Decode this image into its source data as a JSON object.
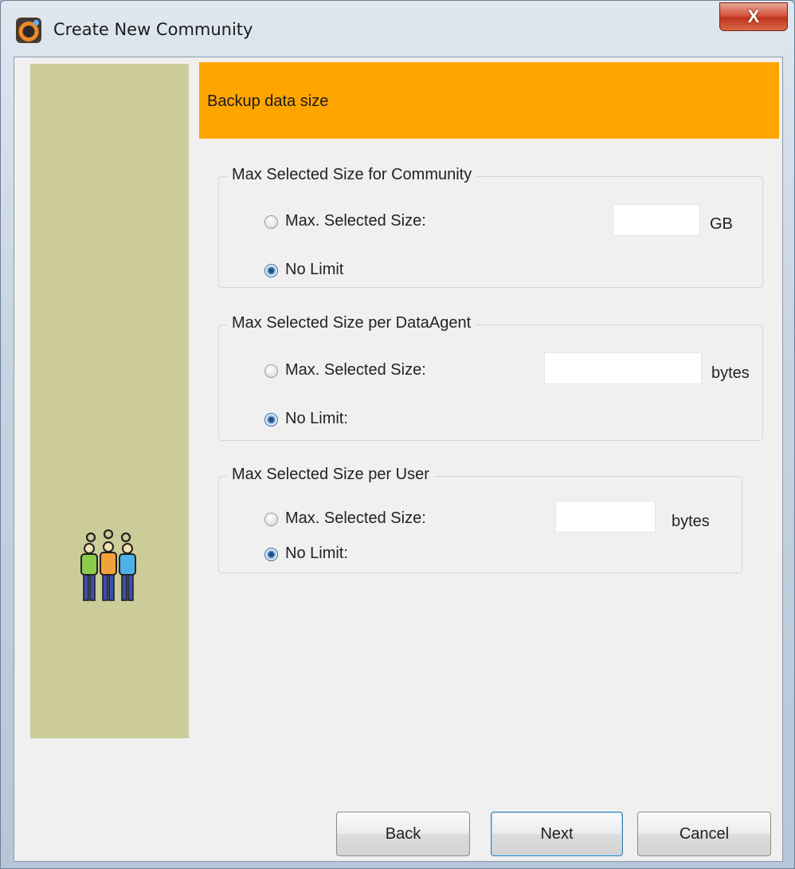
{
  "window": {
    "title": "Create New Community",
    "close_label": "X"
  },
  "header": {
    "title": "Backup data size"
  },
  "groups": [
    {
      "legend": "Max Selected Size for Community",
      "option_size_label": "Max. Selected Size:",
      "option_nolimit_label": "No Limit",
      "unit": "GB",
      "value": "",
      "selected": "no_limit"
    },
    {
      "legend": "Max Selected Size per DataAgent",
      "option_size_label": "Max. Selected Size:",
      "option_nolimit_label": "No Limit:",
      "unit": "bytes",
      "value": "",
      "selected": "no_limit"
    },
    {
      "legend": "Max Selected Size per User",
      "option_size_label": "Max. Selected Size:",
      "option_nolimit_label": "No Limit:",
      "unit": "bytes",
      "value": "",
      "selected": "no_limit"
    }
  ],
  "buttons": {
    "back": "Back",
    "next": "Next",
    "cancel": "Cancel"
  },
  "sidebar": {
    "icon": "people-group-icon"
  },
  "colors": {
    "header_bg": "#ffa500",
    "sidebar_bg": "#cccc99",
    "close_button": "#c7432b"
  }
}
